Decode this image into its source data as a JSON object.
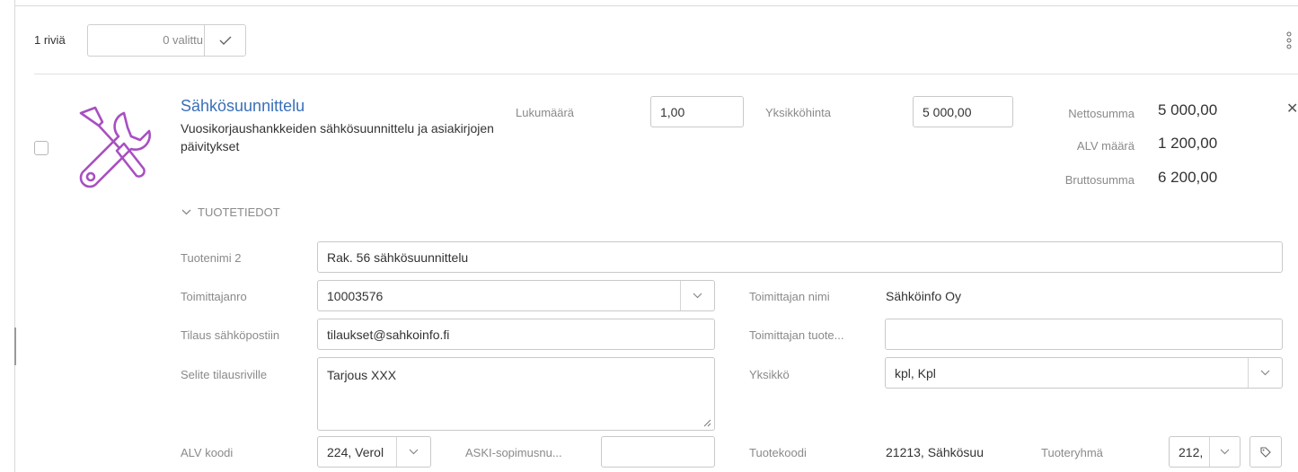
{
  "toolbar": {
    "row_count": "1 riviä",
    "selected": "0 valittu"
  },
  "product": {
    "title": "Sähkösuunnittelu",
    "description": "Vuosikorjaushankkeiden sähkösuunnittelu ja asiakirjojen päivitykset",
    "icon": "tools-icon",
    "icon_color": "#a84fc2",
    "title_color": "#3a6fb8",
    "quantity_label": "Lukumäärä",
    "quantity": "1,00",
    "unit_price_label": "Yksikköhinta",
    "unit_price": "5 000,00"
  },
  "summary": {
    "net_label": "Nettosumma",
    "net": "5 000,00",
    "vat_label": "ALV määrä",
    "vat": "1 200,00",
    "gross_label": "Bruttosumma",
    "gross": "6 200,00"
  },
  "details": {
    "section_label": "TUOTETIEDOT",
    "product_name2_label": "Tuotenimi 2",
    "product_name2": "Rak. 56 sähkösuunnittelu",
    "supplier_no_label": "Toimittajanro",
    "supplier_no": "10003576",
    "supplier_name_label": "Toimittajan nimi",
    "supplier_name": "Sähköinfo Oy",
    "order_email_label": "Tilaus sähköpostiin",
    "order_email": "tilaukset@sahkoinfo.fi",
    "supplier_product_label": "Toimittajan tuote...",
    "supplier_product": "",
    "order_note_label": "Selite tilausriville",
    "order_note": "Tarjous XXX",
    "unit_label": "Yksikkö",
    "unit": "kpl, Kpl",
    "vat_code_label": "ALV koodi",
    "vat_code": "224, Verol",
    "aski_label": "ASKI-sopimusnu...",
    "aski": "",
    "product_code_label": "Tuotekoodi",
    "product_code": "21213, Sähkösuu",
    "product_group_label": "Tuoteryhmä",
    "product_group": "212,"
  }
}
